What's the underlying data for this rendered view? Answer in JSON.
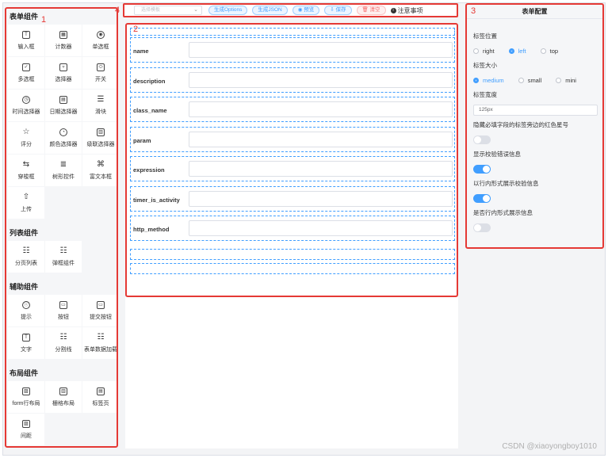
{
  "annotations": {
    "palette": "1",
    "canvas": "2",
    "config": "3",
    "toolbar": "4"
  },
  "palette": {
    "sections": [
      {
        "title": "表单组件",
        "items": [
          {
            "label": "输入框",
            "icon": "input-icon",
            "glyph": "T"
          },
          {
            "label": "计数器",
            "icon": "counter-icon",
            "glyph": "▦"
          },
          {
            "label": "单选框",
            "icon": "radio-icon",
            "glyph": "◉"
          },
          {
            "label": "多选框",
            "icon": "checkbox-icon",
            "glyph": "✓"
          },
          {
            "label": "选择器",
            "icon": "select-icon",
            "glyph": "▿"
          },
          {
            "label": "开关",
            "icon": "switch-icon",
            "glyph": "⬭"
          },
          {
            "label": "时间选择器",
            "icon": "clock-icon",
            "glyph": "◷"
          },
          {
            "label": "日期选择器",
            "icon": "calendar-icon",
            "glyph": "▤"
          },
          {
            "label": "滑块",
            "icon": "slider-icon",
            "glyph": "☰"
          },
          {
            "label": "评分",
            "icon": "star-icon",
            "glyph": "☆"
          },
          {
            "label": "颜色选择器",
            "icon": "palette-icon",
            "glyph": "◔"
          },
          {
            "label": "级联选择器",
            "icon": "cascader-icon",
            "glyph": "▥"
          },
          {
            "label": "穿梭框",
            "icon": "transfer-icon",
            "glyph": "⇆"
          },
          {
            "label": "树形控件",
            "icon": "tree-icon",
            "glyph": "≣"
          },
          {
            "label": "富文本框",
            "icon": "richtext-icon",
            "glyph": "⌘"
          },
          {
            "label": "上传",
            "icon": "upload-icon",
            "glyph": "⇧"
          }
        ]
      },
      {
        "title": "列表组件",
        "items": [
          {
            "label": "分页列表",
            "icon": "list-icon",
            "glyph": "☷"
          },
          {
            "label": "弹框组件",
            "icon": "dialog-icon",
            "glyph": "☷"
          }
        ]
      },
      {
        "title": "辅助组件",
        "items": [
          {
            "label": "提示",
            "icon": "info-icon",
            "glyph": "ⓘ"
          },
          {
            "label": "按钮",
            "icon": "button-icon",
            "glyph": "▭"
          },
          {
            "label": "提交按钮",
            "icon": "submit-button-icon",
            "glyph": "▭"
          },
          {
            "label": "文字",
            "icon": "text-icon",
            "glyph": "T"
          },
          {
            "label": "分割线",
            "icon": "divider-icon",
            "glyph": "☷"
          },
          {
            "label": "表单数据加载",
            "icon": "data-load-icon",
            "glyph": "☷"
          }
        ]
      },
      {
        "title": "布局组件",
        "items": [
          {
            "label": "form行布局",
            "icon": "row-layout-icon",
            "glyph": "▨"
          },
          {
            "label": "栅格布局",
            "icon": "grid-layout-icon",
            "glyph": "▥"
          },
          {
            "label": "标签页",
            "icon": "tabs-icon",
            "glyph": "▤"
          },
          {
            "label": "间距",
            "icon": "spacing-icon",
            "glyph": "▨"
          }
        ]
      }
    ]
  },
  "toolbar": {
    "template_placeholder": "选择模板",
    "buttons": [
      {
        "label": "生成Options",
        "variant": "blue"
      },
      {
        "label": "生成JSON",
        "variant": "blue"
      },
      {
        "label": "◉ 预览",
        "variant": "blue"
      },
      {
        "label": "⇩ 保存",
        "variant": "blue"
      },
      {
        "label": "🗑 清空",
        "variant": "red"
      }
    ],
    "notice": "注意事项"
  },
  "form": {
    "fields": [
      {
        "label": "name"
      },
      {
        "label": "description"
      },
      {
        "label": "class_name"
      },
      {
        "label": "param"
      },
      {
        "label": "expression"
      },
      {
        "label": "timer_is_activity"
      },
      {
        "label": "http_method"
      }
    ]
  },
  "config": {
    "title": "表单配置",
    "label_position": {
      "label": "标签位置",
      "options": [
        "right",
        "left",
        "top"
      ],
      "selected": "left"
    },
    "label_size": {
      "label": "标签大小",
      "options": [
        "medium",
        "small",
        "mini"
      ],
      "selected": "medium"
    },
    "label_width": {
      "label": "标签宽度",
      "value": "125px"
    },
    "switches": [
      {
        "label": "隐藏必填字段的标签旁边的红色星号",
        "on": false
      },
      {
        "label": "显示校验错误信息",
        "on": true
      },
      {
        "label": "以行内形式展示校验信息",
        "on": true
      },
      {
        "label": "是否行内形式展示信息",
        "on": false
      }
    ]
  },
  "watermark": "CSDN @xiaoyongboy1010",
  "colors": {
    "accent": "#409eff",
    "annotation": "#e53935"
  }
}
